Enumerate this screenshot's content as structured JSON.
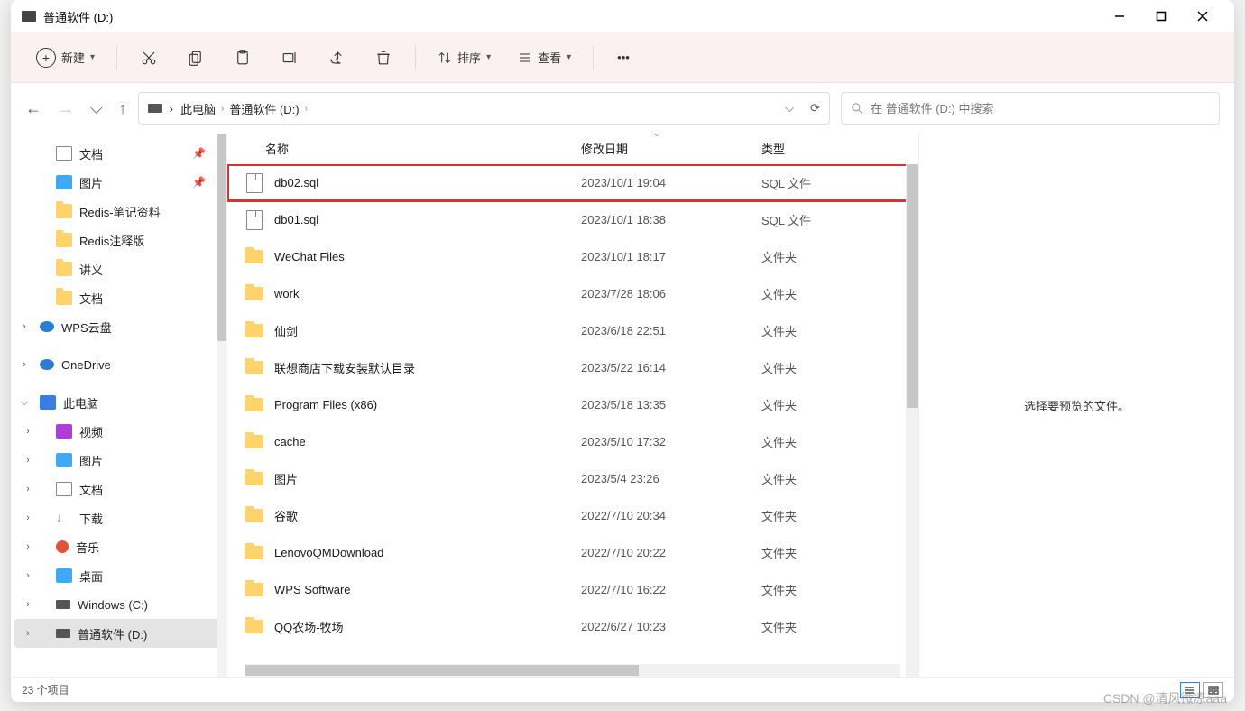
{
  "title": "普通软件 (D:)",
  "toolbar": {
    "new_label": "新建",
    "sort_label": "排序",
    "view_label": "查看"
  },
  "breadcrumb": {
    "root": "此电脑",
    "current": "普通软件 (D:)"
  },
  "search": {
    "placeholder": "在 普通软件 (D:) 中搜索"
  },
  "sidebar": [
    {
      "label": "文档",
      "icon": "doc",
      "pinned": true,
      "level": 2
    },
    {
      "label": "图片",
      "icon": "pic",
      "pinned": true,
      "level": 2
    },
    {
      "label": "Redis-笔记资料",
      "icon": "folder",
      "level": 2
    },
    {
      "label": "Redis注释版",
      "icon": "folder",
      "level": 2
    },
    {
      "label": "讲义",
      "icon": "folder",
      "level": 2
    },
    {
      "label": "文档",
      "icon": "folder",
      "level": 2
    },
    {
      "label": "WPS云盘",
      "icon": "cloud",
      "level": 1,
      "chev": "right"
    },
    {
      "label": "OneDrive",
      "icon": "cloud",
      "level": 1,
      "chev": "right"
    },
    {
      "label": "此电脑",
      "icon": "pc",
      "level": 1,
      "chev": "down"
    },
    {
      "label": "视频",
      "icon": "video",
      "level": 2,
      "chev": "right"
    },
    {
      "label": "图片",
      "icon": "pic",
      "level": 2,
      "chev": "right"
    },
    {
      "label": "文档",
      "icon": "doc",
      "level": 2,
      "chev": "right"
    },
    {
      "label": "下载",
      "icon": "dl",
      "level": 2,
      "chev": "right"
    },
    {
      "label": "音乐",
      "icon": "music",
      "level": 2,
      "chev": "right"
    },
    {
      "label": "桌面",
      "icon": "pic",
      "level": 2,
      "chev": "right"
    },
    {
      "label": "Windows (C:)",
      "icon": "drive",
      "level": 2,
      "chev": "right"
    },
    {
      "label": "普通软件 (D:)",
      "icon": "drive",
      "level": 2,
      "chev": "right",
      "selected": true
    }
  ],
  "columns": {
    "name": "名称",
    "date": "修改日期",
    "type": "类型"
  },
  "files": [
    {
      "name": "db02.sql",
      "date": "2023/10/1 19:04",
      "type": "SQL 文件",
      "kind": "file",
      "highlighted": true
    },
    {
      "name": "db01.sql",
      "date": "2023/10/1 18:38",
      "type": "SQL 文件",
      "kind": "file"
    },
    {
      "name": "WeChat Files",
      "date": "2023/10/1 18:17",
      "type": "文件夹",
      "kind": "folder"
    },
    {
      "name": "work",
      "date": "2023/7/28 18:06",
      "type": "文件夹",
      "kind": "folder"
    },
    {
      "name": "仙剑",
      "date": "2023/6/18 22:51",
      "type": "文件夹",
      "kind": "folder"
    },
    {
      "name": "联想商店下载安装默认目录",
      "date": "2023/5/22 16:14",
      "type": "文件夹",
      "kind": "folder"
    },
    {
      "name": "Program Files (x86)",
      "date": "2023/5/18 13:35",
      "type": "文件夹",
      "kind": "folder"
    },
    {
      "name": "cache",
      "date": "2023/5/10 17:32",
      "type": "文件夹",
      "kind": "folder"
    },
    {
      "name": "图片",
      "date": "2023/5/4 23:26",
      "type": "文件夹",
      "kind": "folder"
    },
    {
      "name": "谷歌",
      "date": "2022/7/10 20:34",
      "type": "文件夹",
      "kind": "folder"
    },
    {
      "name": "LenovoQMDownload",
      "date": "2022/7/10 20:22",
      "type": "文件夹",
      "kind": "folder"
    },
    {
      "name": "WPS Software",
      "date": "2022/7/10 16:22",
      "type": "文件夹",
      "kind": "folder"
    },
    {
      "name": "QQ农场-牧场",
      "date": "2022/6/27 10:23",
      "type": "文件夹",
      "kind": "folder"
    }
  ],
  "preview": {
    "text": "选择要预览的文件。"
  },
  "status": {
    "items": "23 个项目"
  },
  "watermark": "CSDN @清风微凉aaa"
}
